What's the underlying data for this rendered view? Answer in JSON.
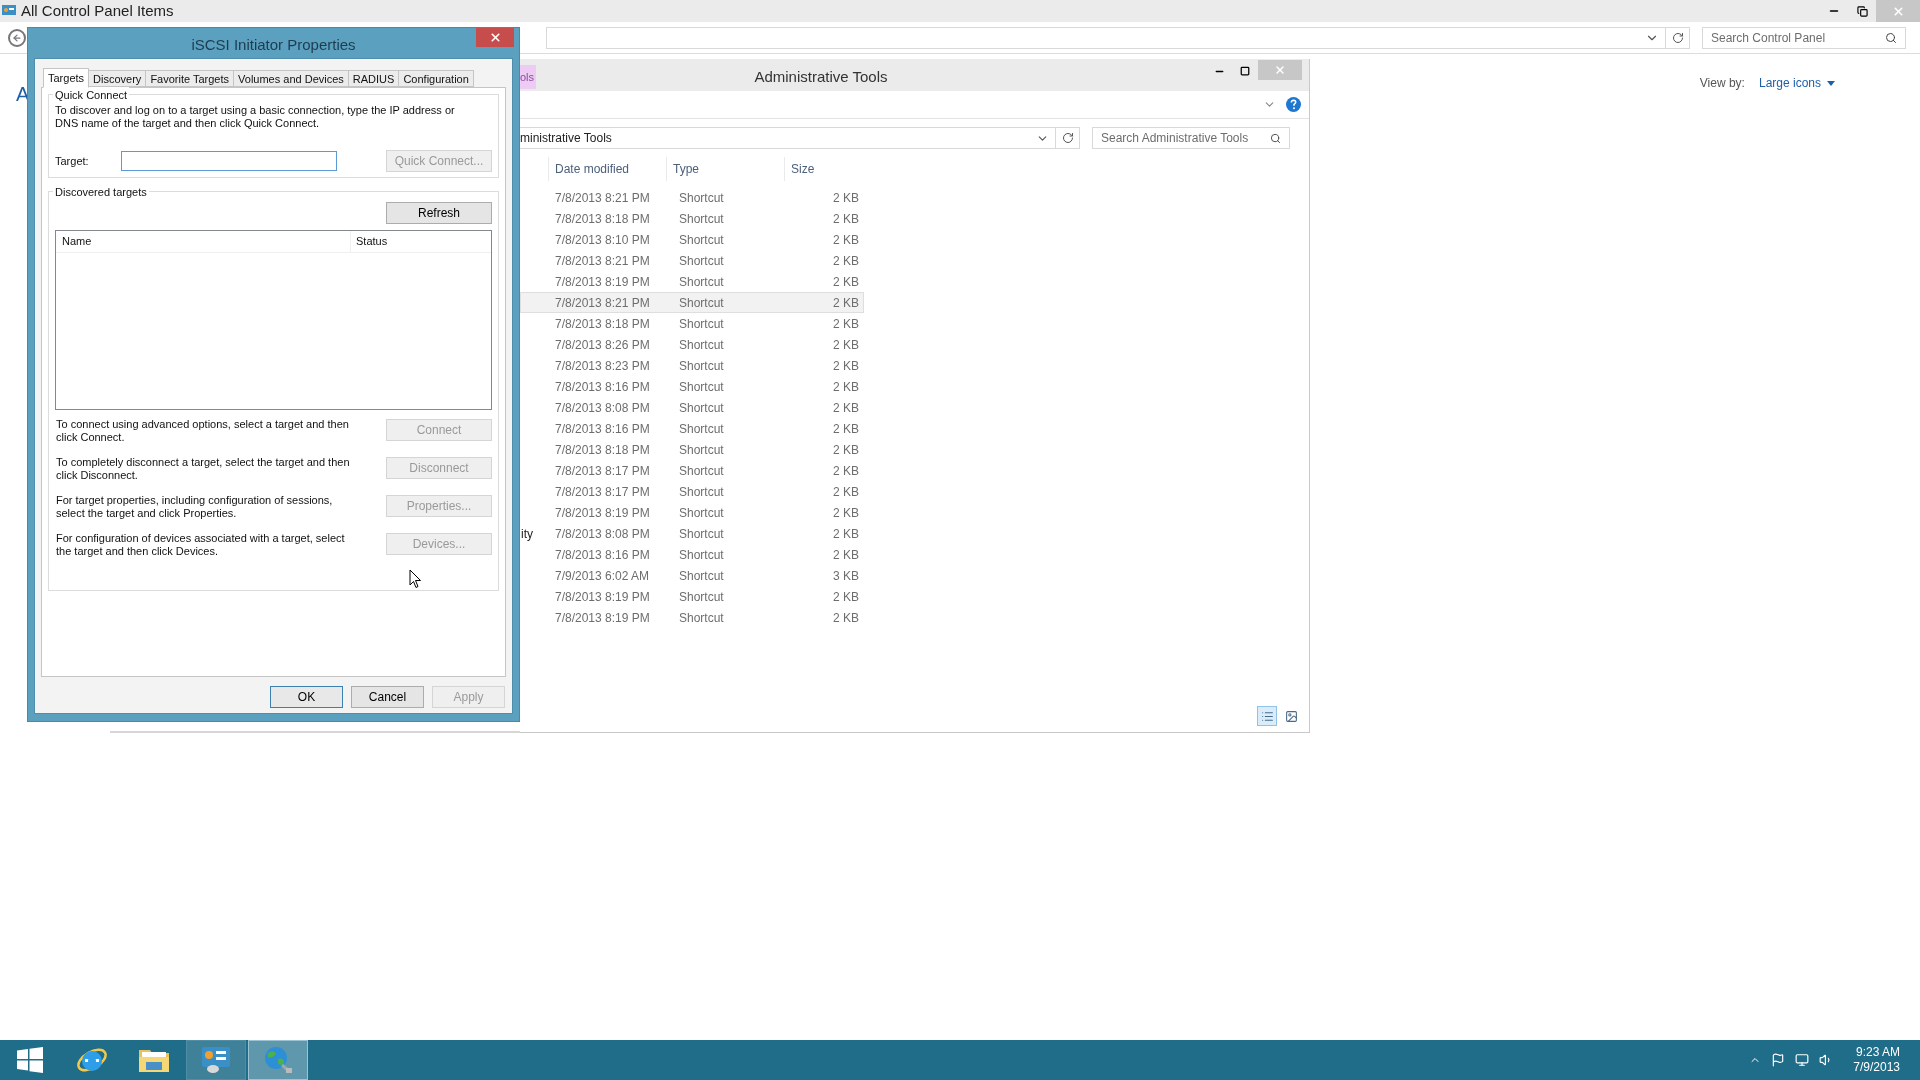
{
  "background_window": {
    "title": "All Control Panel Items",
    "search": {
      "placeholder": "Search Control Panel"
    },
    "heading_fragment": "A",
    "view_by": {
      "label": "View by:",
      "value": "Large icons"
    }
  },
  "admin_window": {
    "title": "Administrative Tools",
    "tab_fragment": "ols",
    "address": "ministrative Tools",
    "search": {
      "placeholder": "Search Administrative Tools"
    },
    "columns": [
      "Date modified",
      "Type",
      "Size"
    ],
    "rows": [
      {
        "date": "7/8/2013 8:21 PM",
        "type": "Shortcut",
        "size": "2 KB",
        "selected": false
      },
      {
        "date": "7/8/2013 8:18 PM",
        "type": "Shortcut",
        "size": "2 KB",
        "selected": false
      },
      {
        "date": "7/8/2013 8:10 PM",
        "type": "Shortcut",
        "size": "2 KB",
        "selected": false
      },
      {
        "date": "7/8/2013 8:21 PM",
        "type": "Shortcut",
        "size": "2 KB",
        "selected": false
      },
      {
        "date": "7/8/2013 8:19 PM",
        "type": "Shortcut",
        "size": "2 KB",
        "selected": false
      },
      {
        "date": "7/8/2013 8:21 PM",
        "type": "Shortcut",
        "size": "2 KB",
        "selected": true
      },
      {
        "date": "7/8/2013 8:18 PM",
        "type": "Shortcut",
        "size": "2 KB",
        "selected": false
      },
      {
        "date": "7/8/2013 8:26 PM",
        "type": "Shortcut",
        "size": "2 KB",
        "selected": false
      },
      {
        "date": "7/8/2013 8:23 PM",
        "type": "Shortcut",
        "size": "2 KB",
        "selected": false
      },
      {
        "date": "7/8/2013 8:16 PM",
        "type": "Shortcut",
        "size": "2 KB",
        "selected": false
      },
      {
        "date": "7/8/2013 8:08 PM",
        "type": "Shortcut",
        "size": "2 KB",
        "selected": false
      },
      {
        "date": "7/8/2013 8:16 PM",
        "type": "Shortcut",
        "size": "2 KB",
        "selected": false
      },
      {
        "date": "7/8/2013 8:18 PM",
        "type": "Shortcut",
        "size": "2 KB",
        "selected": false
      },
      {
        "date": "7/8/2013 8:17 PM",
        "type": "Shortcut",
        "size": "2 KB",
        "selected": false
      },
      {
        "date": "7/8/2013 8:17 PM",
        "type": "Shortcut",
        "size": "2 KB",
        "selected": false
      },
      {
        "date": "7/8/2013 8:19 PM",
        "type": "Shortcut",
        "size": "2 KB",
        "selected": false
      },
      {
        "name": "ity",
        "date": "7/8/2013 8:08 PM",
        "type": "Shortcut",
        "size": "2 KB",
        "selected": false
      },
      {
        "date": "7/8/2013 8:16 PM",
        "type": "Shortcut",
        "size": "2 KB",
        "selected": false
      },
      {
        "date": "7/9/2013 6:02 AM",
        "type": "Shortcut",
        "size": "3 KB",
        "selected": false
      },
      {
        "date": "7/8/2013 8:19 PM",
        "type": "Shortcut",
        "size": "2 KB",
        "selected": false
      },
      {
        "date": "7/8/2013 8:19 PM",
        "type": "Shortcut",
        "size": "2 KB",
        "selected": false
      }
    ]
  },
  "dialog": {
    "title": "iSCSI Initiator Properties",
    "tabs": [
      {
        "label": "Targets",
        "selected": true
      },
      {
        "label": "Discovery",
        "selected": false
      },
      {
        "label": "Favorite Targets",
        "selected": false
      },
      {
        "label": "Volumes and Devices",
        "selected": false
      },
      {
        "label": "RADIUS",
        "selected": false
      },
      {
        "label": "Configuration",
        "selected": false
      }
    ],
    "quick_connect": {
      "legend": "Quick Connect",
      "description": "To discover and log on to a target using a basic connection, type the IP address or DNS name of the target and then click Quick Connect.",
      "target_label": "Target:",
      "button": {
        "label": "Quick Connect...",
        "disabled": true
      }
    },
    "discovered": {
      "legend": "Discovered targets",
      "refresh": {
        "label": "Refresh",
        "disabled": false
      },
      "columns": [
        "Name",
        "Status"
      ],
      "actions": [
        {
          "description": "To connect using advanced options, select a target and then click Connect.",
          "button": {
            "label": "Connect",
            "disabled": true
          }
        },
        {
          "description": "To completely disconnect a target, select the target and then click Disconnect.",
          "button": {
            "label": "Disconnect",
            "disabled": true
          }
        },
        {
          "description": "For target properties, including configuration of sessions, select the target and click Properties.",
          "button": {
            "label": "Properties...",
            "disabled": true
          }
        },
        {
          "description": "For configuration of devices associated with a target, select the target and then click Devices.",
          "button": {
            "label": "Devices...",
            "disabled": true
          }
        }
      ]
    },
    "buttons": [
      {
        "label": "OK",
        "disabled": false,
        "default": true
      },
      {
        "label": "Cancel",
        "disabled": false,
        "default": false
      },
      {
        "label": "Apply",
        "disabled": true,
        "default": false
      }
    ]
  },
  "taskbar": {
    "items": [
      {
        "kind": "start",
        "running": false,
        "selected": false
      },
      {
        "kind": "browser",
        "running": false,
        "selected": false
      },
      {
        "kind": "folder",
        "running": false,
        "selected": false
      },
      {
        "kind": "control-panel",
        "running": true,
        "selected": false
      },
      {
        "kind": "iscsi",
        "running": true,
        "selected": true
      }
    ],
    "clock": {
      "time": "9:23 AM",
      "date": "7/9/2013"
    }
  }
}
